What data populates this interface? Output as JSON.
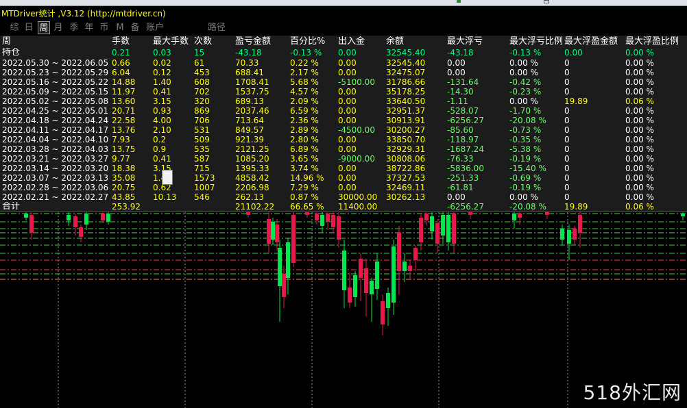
{
  "title": "MTDriver统计 ,V3.12 (http://mtdriver.cn)",
  "tabs": [
    {
      "label": "综",
      "active": false
    },
    {
      "label": "日",
      "active": false
    },
    {
      "label": "周",
      "active": true
    },
    {
      "label": "月",
      "active": false
    },
    {
      "label": "季",
      "active": false
    },
    {
      "label": "年",
      "active": false
    },
    {
      "label": "币",
      "active": false
    },
    {
      "label": "M",
      "active": false
    },
    {
      "label": "备",
      "active": false
    },
    {
      "label": "账户",
      "active": false
    },
    {
      "label": "路径",
      "active": false
    }
  ],
  "columns": [
    "周",
    "手数",
    "最大手数",
    "次数",
    "盈亏金额",
    "百分比%",
    "出入金",
    "余额",
    "最大浮亏",
    "最大浮亏比例",
    "最大浮盈金额",
    "最大浮盈比例"
  ],
  "holding": {
    "label": "持仓",
    "cells": [
      "0.21",
      "0.03",
      "15",
      "-43.18",
      "-0.13 %",
      "0.00",
      "32545.40",
      "-43.18",
      "-0.13 %",
      "0.00",
      "0.00 %"
    ]
  },
  "rows": [
    {
      "period": "2022.05.30 ~ 2022.06.05",
      "cells": [
        "0.66",
        "0.02",
        "61",
        "70.33",
        "0.22 %",
        "0.00",
        "32545.40",
        "0.00",
        "0.00 %",
        "0",
        "0.00 %"
      ]
    },
    {
      "period": "2022.05.23 ~ 2022.05.29",
      "cells": [
        "6.04",
        "0.12",
        "453",
        "688.41",
        "2.17 %",
        "0.00",
        "32475.07",
        "0.00",
        "0.00 %",
        "0",
        "0.00 %"
      ]
    },
    {
      "period": "2022.05.16 ~ 2022.05.22",
      "cells": [
        "14.88",
        "1.40",
        "608",
        "1708.41",
        "5.68 %",
        "-5100.00",
        "31786.66",
        "-131.64",
        "-0.42 %",
        "0",
        "0.00 %"
      ]
    },
    {
      "period": "2022.05.09 ~ 2022.05.15",
      "cells": [
        "11.97",
        "0.41",
        "702",
        "1537.75",
        "4.57 %",
        "0.00",
        "35178.25",
        "-14.30",
        "-0.23 %",
        "0",
        "0.00 %"
      ]
    },
    {
      "period": "2022.05.02 ~ 2022.05.08",
      "cells": [
        "13.60",
        "3.15",
        "320",
        "689.13",
        "2.09 %",
        "0.00",
        "33640.50",
        "-1.11",
        "0.00 %",
        "19.89",
        "0.06 %"
      ]
    },
    {
      "period": "2022.04.25 ~ 2022.05.01",
      "cells": [
        "20.71",
        "0.93",
        "869",
        "2037.46",
        "6.59 %",
        "0.00",
        "32951.37",
        "-528.07",
        "-1.70 %",
        "0",
        "0.00 %"
      ]
    },
    {
      "period": "2022.04.18 ~ 2022.04.24",
      "cells": [
        "22.58",
        "4.00",
        "706",
        "713.64",
        "2.36 %",
        "0.00",
        "30913.91",
        "-6256.27",
        "-20.08 %",
        "0",
        "0.00 %"
      ]
    },
    {
      "period": "2022.04.11 ~ 2022.04.17",
      "cells": [
        "13.76",
        "2.10",
        "531",
        "849.57",
        "2.89 %",
        "-4500.00",
        "30200.27",
        "-85.60",
        "-0.73 %",
        "0",
        "0.00 %"
      ]
    },
    {
      "period": "2022.04.04 ~ 2022.04.10",
      "cells": [
        "7.93",
        "0.2",
        "509",
        "921.39",
        "2.80 %",
        "0.00",
        "33850.70",
        "-118.97",
        "-0.35 %",
        "0",
        "0.00 %"
      ]
    },
    {
      "period": "2022.03.28 ~ 2022.04.03",
      "cells": [
        "13.75",
        "0.9",
        "535",
        "2121.25",
        "6.89 %",
        "0.00",
        "32929.31",
        "-1687.24",
        "-5.38 %",
        "0",
        "0.00 %"
      ]
    },
    {
      "period": "2022.03.21 ~ 2022.03.27",
      "cells": [
        "9.77",
        "0.41",
        "587",
        "1085.20",
        "3.65 %",
        "-9000.00",
        "30808.06",
        "-76.33",
        "-0.19 %",
        "0",
        "0.00 %"
      ]
    },
    {
      "period": "2022.03.14 ~ 2022.03.20",
      "cells": [
        "18.38",
        "3.15",
        "715",
        "1395.33",
        "3.74 %",
        "0.00",
        "38722.86",
        "-5836.00",
        "-15.40 %",
        "0",
        "0.00 %"
      ]
    },
    {
      "period": "2022.03.07 ~ 2022.03.13",
      "cells": [
        "35.08",
        "1.40",
        "1573",
        "4858.42",
        "14.96 %",
        "0.00",
        "37327.53",
        "-251.33",
        "-0.69 %",
        "0",
        "0.00 %"
      ]
    },
    {
      "period": "2022.02.28 ~ 2022.03.06",
      "cells": [
        "20.75",
        "0.62",
        "1007",
        "2206.98",
        "7.29 %",
        "0.00",
        "32469.11",
        "-61.81",
        "-0.19 %",
        "0",
        "0.00 %"
      ]
    },
    {
      "period": "2022.02.21 ~ 2022.02.27",
      "cells": [
        "43.85",
        "10.13",
        "546",
        "262.13",
        "0.87 %",
        "30000.00",
        "30262.13",
        "0.00",
        "0.00 %",
        "0",
        "0.00 %"
      ]
    }
  ],
  "total": {
    "label": "合计",
    "cells": [
      "253.92",
      "",
      "",
      "21102.22",
      "66.65 %",
      "11400.00",
      "",
      "-6256.27",
      "-20.08 %",
      "19.89",
      "0.06 %"
    ]
  },
  "colors": {
    "header": "#ffffff",
    "value": "#ffff00",
    "holding": "#00ff7f",
    "gain": "#00ff7f",
    "negative": "#66ff66",
    "bull_candle": "#00e64d",
    "bear_candle": "#e6194b"
  },
  "watermark": "518外汇网"
}
